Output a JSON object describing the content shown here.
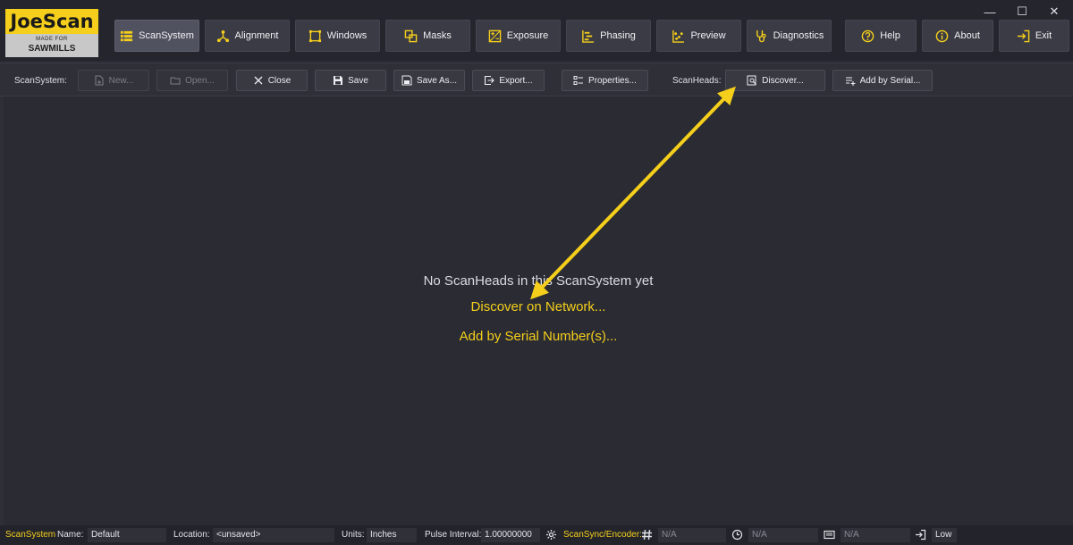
{
  "logo": {
    "name": "JoeScan",
    "tag_line1": "MADE FOR",
    "tag_line2": "SAWMILLS"
  },
  "window_controls": {
    "minimize": "—",
    "maximize": "☐",
    "close": "✕"
  },
  "nav": {
    "items": [
      {
        "label": "ScanSystem",
        "icon": "table-icon",
        "active": true
      },
      {
        "label": "Alignment",
        "icon": "alignment-icon"
      },
      {
        "label": "Windows",
        "icon": "windows-icon"
      },
      {
        "label": "Masks",
        "icon": "masks-icon"
      },
      {
        "label": "Exposure",
        "icon": "exposure-icon"
      },
      {
        "label": "Phasing",
        "icon": "phasing-icon"
      },
      {
        "label": "Preview",
        "icon": "preview-icon"
      },
      {
        "label": "Diagnostics",
        "icon": "stethoscope-icon"
      },
      {
        "label": "Help",
        "icon": "help-icon"
      },
      {
        "label": "About",
        "icon": "info-icon"
      },
      {
        "label": "Exit",
        "icon": "exit-icon"
      }
    ]
  },
  "toolbar": {
    "scansystem_label": "ScanSystem:",
    "new_label": "New...",
    "open_label": "Open...",
    "close_label": "Close",
    "save_label": "Save",
    "save_as_label": "Save As...",
    "export_label": "Export...",
    "properties_label": "Properties...",
    "scanheads_label": "ScanHeads:",
    "discover_label": "Discover...",
    "add_serial_label": "Add by Serial..."
  },
  "main": {
    "empty_message": "No ScanHeads in this ScanSystem yet",
    "discover_link": "Discover on Network...",
    "add_serial_link": "Add by Serial Number(s)..."
  },
  "status": {
    "scansystem": "ScanSystem",
    "name_label": "Name:",
    "name_value": "Default",
    "location_label": "Location:",
    "location_value": "<unsaved>",
    "units_label": "Units:",
    "units_value": "Inches",
    "pulse_label": "Pulse Interval:",
    "pulse_value": "1.00000000",
    "encoder_label": "ScanSync/Encoder:",
    "encoder_value": "N/A",
    "time_value": "N/A",
    "card_value": "N/A",
    "level_value": "Low"
  },
  "colors": {
    "accent": "#f5cf1b",
    "background": "#2a2b33",
    "button": "#3a3b44"
  }
}
